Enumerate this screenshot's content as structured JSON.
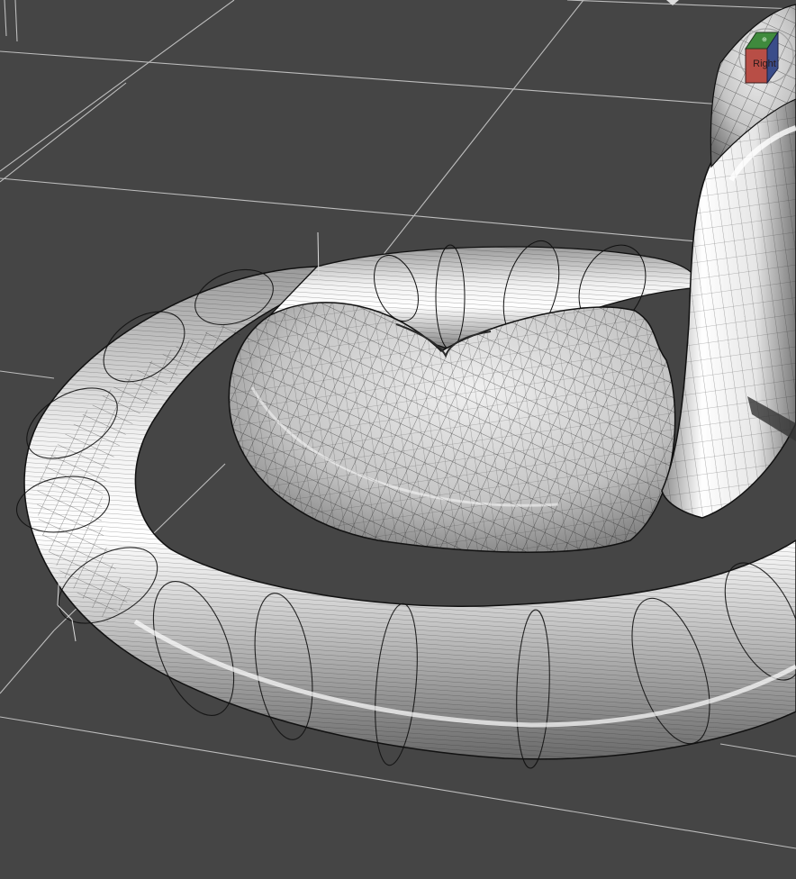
{
  "viewport": {
    "background": "#454545",
    "grid_color": "#bdbdbd",
    "mesh_color": "#111111",
    "surface_light": "#f4f4f4",
    "surface_dark": "#6a6a6a"
  },
  "viewcube": {
    "face_label": "Right",
    "right_face_color": "#b84e46",
    "top_face_color": "#3f8a3d",
    "side_face_color": "#3a4d8a"
  },
  "icons": {
    "viewcube": "navigation-cube-icon",
    "compass": "compass-ring-icon",
    "marker": "viewport-marker-icon"
  }
}
